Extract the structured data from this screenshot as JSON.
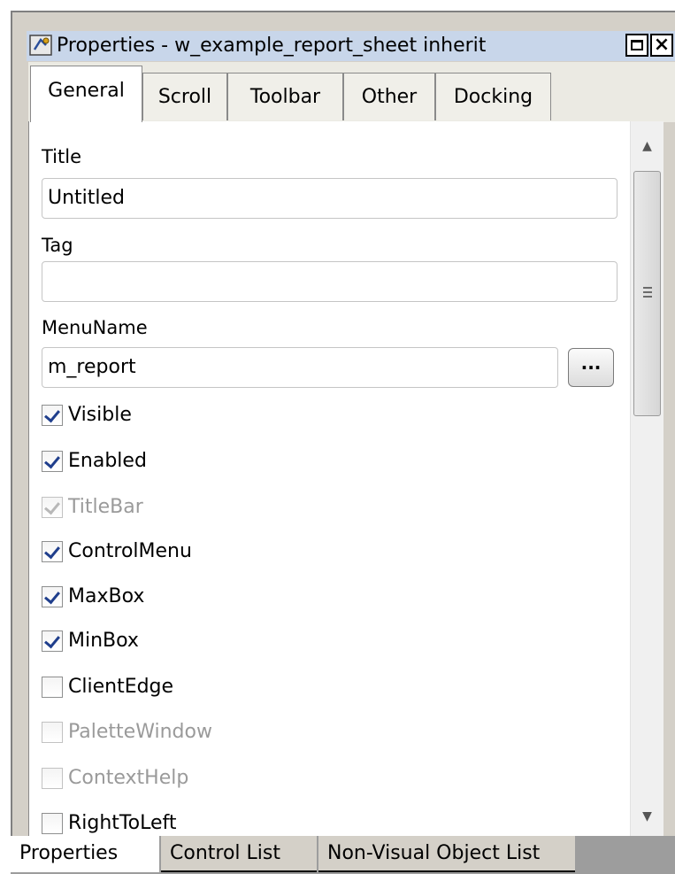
{
  "window": {
    "title": "Properties - w_example_report_sheet  inherit",
    "restore_icon": "restore-icon",
    "close_label": "×"
  },
  "tabs": [
    "General",
    "Scroll",
    "Toolbar",
    "Other",
    "Docking"
  ],
  "active_tab": "General",
  "fields": {
    "title": {
      "label": "Title",
      "value": "Untitled"
    },
    "tag": {
      "label": "Tag",
      "value": ""
    },
    "menuname": {
      "label": "MenuName",
      "value": "m_report",
      "button_label": "..."
    }
  },
  "checkboxes": [
    {
      "label": "Visible",
      "checked": true,
      "enabled": true
    },
    {
      "label": "Enabled",
      "checked": true,
      "enabled": true
    },
    {
      "label": "TitleBar",
      "checked": true,
      "enabled": false
    },
    {
      "label": "ControlMenu",
      "checked": true,
      "enabled": true
    },
    {
      "label": "MaxBox",
      "checked": true,
      "enabled": true
    },
    {
      "label": "MinBox",
      "checked": true,
      "enabled": true
    },
    {
      "label": "ClientEdge",
      "checked": false,
      "enabled": true
    },
    {
      "label": "PaletteWindow",
      "checked": false,
      "enabled": false
    },
    {
      "label": "ContextHelp",
      "checked": false,
      "enabled": false
    },
    {
      "label": "RightToLeft",
      "checked": false,
      "enabled": true
    }
  ],
  "bottom_tabs": [
    "Properties",
    "Control List",
    "Non-Visual Object List"
  ],
  "active_bottom_tab": "Properties",
  "colors": {
    "titlebar": "#c8d6ea",
    "check_mark": "#1f3e8c",
    "disabled_text": "#9a9a9a"
  }
}
